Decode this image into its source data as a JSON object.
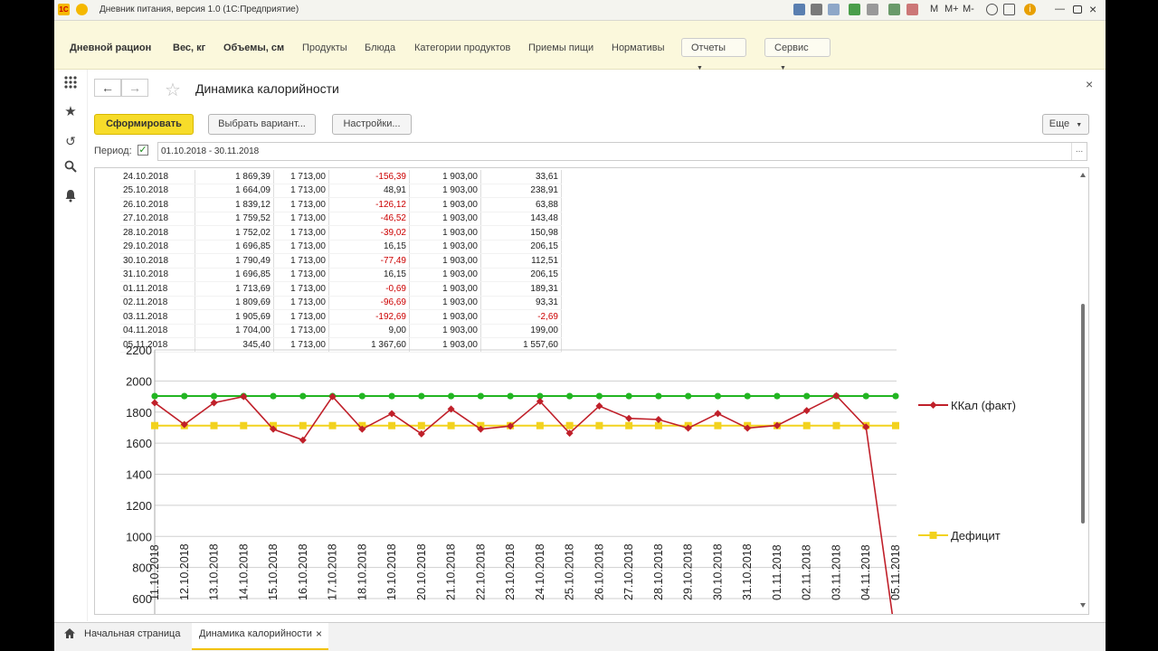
{
  "window": {
    "title": "Дневник питания, версия 1.0  (1С:Предприятие)",
    "toolbar_letters": [
      "M",
      "M+",
      "M-"
    ]
  },
  "menu": {
    "items": [
      {
        "label": "Дневной рацион",
        "bold": true
      },
      {
        "label": "Вес, кг",
        "bold": true
      },
      {
        "label": "Объемы, см",
        "bold": true
      },
      {
        "label": "Продукты",
        "bold": false
      },
      {
        "label": "Блюда",
        "bold": false
      },
      {
        "label": "Категории продуктов",
        "bold": false
      },
      {
        "label": "Приемы пищи",
        "bold": false
      },
      {
        "label": "Нормативы",
        "bold": false
      }
    ],
    "reports_label": "Отчеты",
    "service_label": "Сервис"
  },
  "form": {
    "title": "Динамика калорийности",
    "generate_label": "Сформировать",
    "variant_label": "Выбрать вариант...",
    "settings_label": "Настройки...",
    "more_label": "Еще",
    "period_label": "Период:",
    "period_value": "01.10.2018 - 30.11.2018",
    "period_checked": true
  },
  "table": {
    "rows": [
      [
        "24.10.2018",
        "1 869,39",
        "1 713,00",
        "-156,39",
        "1 903,00",
        "33,61"
      ],
      [
        "25.10.2018",
        "1 664,09",
        "1 713,00",
        "48,91",
        "1 903,00",
        "238,91"
      ],
      [
        "26.10.2018",
        "1 839,12",
        "1 713,00",
        "-126,12",
        "1 903,00",
        "63,88"
      ],
      [
        "27.10.2018",
        "1 759,52",
        "1 713,00",
        "-46,52",
        "1 903,00",
        "143,48"
      ],
      [
        "28.10.2018",
        "1 752,02",
        "1 713,00",
        "-39,02",
        "1 903,00",
        "150,98"
      ],
      [
        "29.10.2018",
        "1 696,85",
        "1 713,00",
        "16,15",
        "1 903,00",
        "206,15"
      ],
      [
        "30.10.2018",
        "1 790,49",
        "1 713,00",
        "-77,49",
        "1 903,00",
        "112,51"
      ],
      [
        "31.10.2018",
        "1 696,85",
        "1 713,00",
        "16,15",
        "1 903,00",
        "206,15"
      ],
      [
        "01.11.2018",
        "1 713,69",
        "1 713,00",
        "-0,69",
        "1 903,00",
        "189,31"
      ],
      [
        "02.11.2018",
        "1 809,69",
        "1 713,00",
        "-96,69",
        "1 903,00",
        "93,31"
      ],
      [
        "03.11.2018",
        "1 905,69",
        "1 713,00",
        "-192,69",
        "1 903,00",
        "-2,69"
      ],
      [
        "04.11.2018",
        "1 704,00",
        "1 713,00",
        "9,00",
        "1 903,00",
        "199,00"
      ],
      [
        "05.11.2018",
        "345,40",
        "1 713,00",
        "1 367,60",
        "1 903,00",
        "1 557,60"
      ]
    ]
  },
  "chart_data": {
    "type": "line",
    "ylim": [
      600,
      2200
    ],
    "yticks": [
      2200,
      2000,
      1800,
      1600,
      1400,
      1200,
      1000,
      800,
      600
    ],
    "grid": true,
    "legend_position": "right",
    "categories": [
      "11.10.2018",
      "12.10.2018",
      "13.10.2018",
      "14.10.2018",
      "15.10.2018",
      "16.10.2018",
      "17.10.2018",
      "18.10.2018",
      "19.10.2018",
      "20.10.2018",
      "21.10.2018",
      "22.10.2018",
      "23.10.2018",
      "24.10.2018",
      "25.10.2018",
      "26.10.2018",
      "27.10.2018",
      "28.10.2018",
      "29.10.2018",
      "30.10.2018",
      "31.10.2018",
      "01.11.2018",
      "02.11.2018",
      "03.11.2018",
      "04.11.2018",
      "05.11.2018"
    ],
    "series": [
      {
        "name": "ККал (факт)",
        "color": "#c0202a",
        "marker": "diamond",
        "values": [
          1860,
          1720,
          1860,
          1900,
          1690,
          1620,
          1900,
          1690,
          1790,
          1660,
          1820,
          1690,
          1710,
          1869.39,
          1664.09,
          1839.12,
          1759.52,
          1752.02,
          1696.85,
          1790.49,
          1696.85,
          1713.69,
          1809.69,
          1905.69,
          1704,
          345.4
        ]
      },
      {
        "name": "Дефицит",
        "color": "#f2d21e",
        "marker": "square",
        "values": [
          1713,
          1713,
          1713,
          1713,
          1713,
          1713,
          1713,
          1713,
          1713,
          1713,
          1713,
          1713,
          1713,
          1713,
          1713,
          1713,
          1713,
          1713,
          1713,
          1713,
          1713,
          1713,
          1713,
          1713,
          1713,
          1713
        ]
      },
      {
        "name": "",
        "color": "#22b522",
        "marker": "circle",
        "values": [
          1903,
          1903,
          1903,
          1903,
          1903,
          1903,
          1903,
          1903,
          1903,
          1903,
          1903,
          1903,
          1903,
          1903,
          1903,
          1903,
          1903,
          1903,
          1903,
          1903,
          1903,
          1903,
          1903,
          1903,
          1903,
          1903
        ]
      }
    ]
  },
  "tabs": {
    "home_label": "Начальная страница",
    "active_label": "Динамика калорийности"
  }
}
